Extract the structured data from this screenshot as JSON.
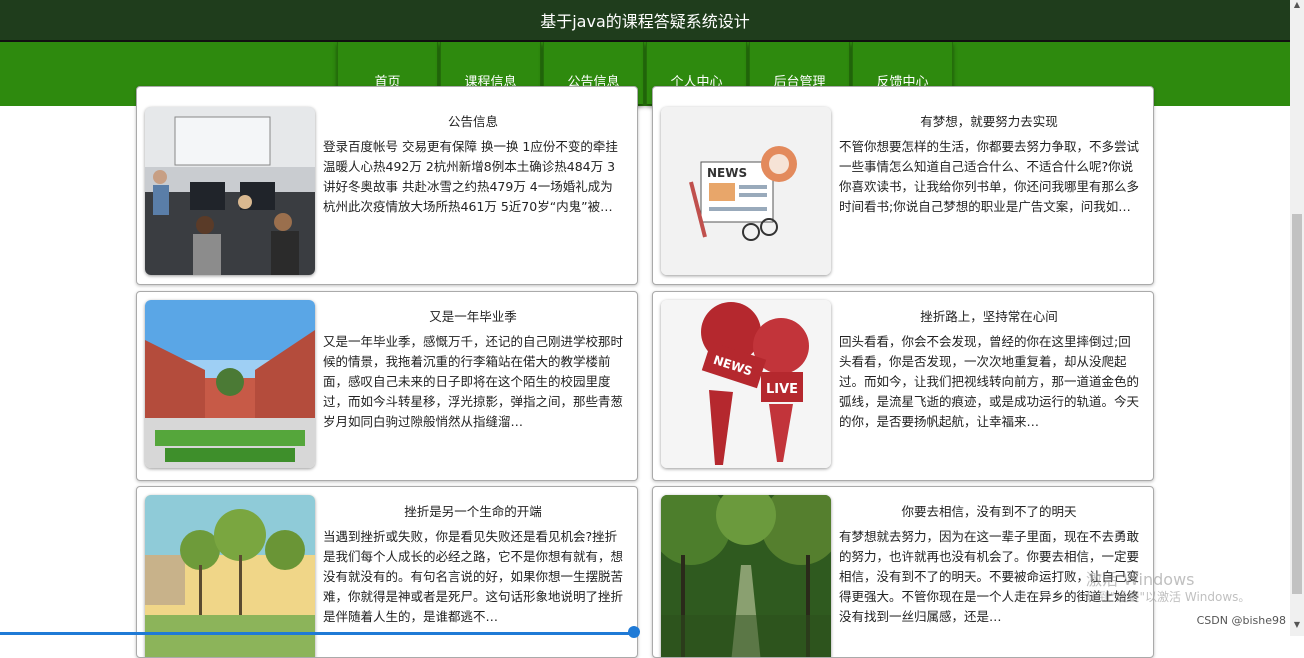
{
  "header": {
    "title": "基于java的课程答疑系统设计"
  },
  "nav": {
    "items": [
      "首页",
      "课程信息",
      "公告信息",
      "个人中心",
      "后台管理",
      "反馈中心"
    ]
  },
  "cards": [
    {
      "title": "公告信息",
      "text": "登录百度帐号 交易更有保障 换一换 1应份不变的牵挂温暖人心热492万 2杭州新增8例本土确诊热484万 3讲好冬奥故事 共赴冰雪之约热479万 4一场婚礼成为杭州此次疫情放大场所热461万 5近70岁“内鬼”被判死缓 细节披露454万 6生育八孩…"
    },
    {
      "title": "有梦想，就要努力去实现",
      "text": "不管你想要怎样的生活，你都要去努力争取，不多尝试一些事情怎么知道自己适合什么、不适合什么呢?你说你喜欢读书，让我给你列书单，你还问我哪里有那么多时间看书;你说自己梦想的职业是广告文案，问我如何成为一个文案，应该具备哪些素…"
    },
    {
      "title": "又是一年毕业季",
      "text": "又是一年毕业季，感慨万千，还记的自己刚进学校那时候的情景，我拖着沉重的行李箱站在偌大的教学楼前面，感叹自己未来的日子即将在这个陌生的校园里度过，而如今斗转星移，浮光掠影，弹指之间，那些青葱岁月如同白驹过隙般悄然从指缝溜…"
    },
    {
      "title": "挫折路上，坚持常在心间",
      "text": "回头看看，你会不会发现，曾经的你在这里摔倒过;回头看看，你是否发现，一次次地重复着，却从没爬起过。而如今，让我们把视线转向前方，那一道道金色的弧线，是流星飞逝的痕迹，或是成功运行的轨道。今天的你，是否要扬帆起航，让幸福来…"
    },
    {
      "title": "挫折是另一个生命的开端",
      "text": "当遇到挫折或失败，你是看见失败还是看见机会?挫折是我们每个人成长的必经之路，它不是你想有就有，想没有就没有的。有句名言说的好，如果你想一生摆脱苦难，你就得是神或者是死尸。这句话形象地说明了挫折是伴随着人生的，是谁都逃不…"
    },
    {
      "title": "你要去相信，没有到不了的明天",
      "text": "有梦想就去努力，因为在这一辈子里面，现在不去勇敢的努力，也许就再也没有机会了。你要去相信，一定要相信，没有到不了的明天。不要被命运打败，让自己变得更强大。不管你现在是一个人走在异乡的街道上始终没有找到一丝归属感，还是…"
    }
  ],
  "image_labels": {
    "news": "NEWS",
    "mic_news": "NEWS",
    "mic_live": "LIVE"
  },
  "watermark": {
    "line1": "激活 Windows",
    "line2": "转到\"设置\"以激活 Windows。"
  },
  "credit": "CSDN @bishe98",
  "colors": {
    "topbar": "#1f3d1c",
    "navbar": "#2e8a0e"
  }
}
